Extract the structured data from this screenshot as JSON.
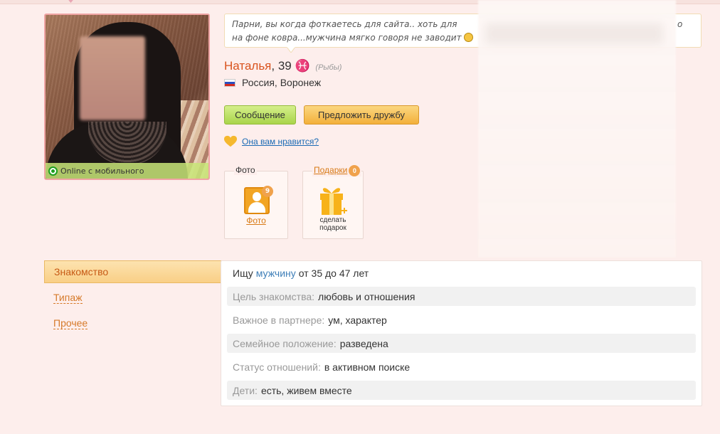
{
  "status": {
    "line1": "Парни, вы когда фоткаетесь для сайта.. хоть для",
    "line1_tail": "о",
    "line2": "на фоне ковра...мужчина мягко говоря не заводит"
  },
  "profile": {
    "name": "Наталья",
    "age": "39",
    "zodiac_symbol": "♓",
    "zodiac": "(Рыбы)",
    "location": "Россия, Воронеж",
    "online": "Online с мобильного"
  },
  "actions": {
    "message": "Сообщение",
    "friend": "Предложить дружбу",
    "like": "Она вам нравится?"
  },
  "photos": {
    "title": "Фото",
    "count": "9",
    "link": "Фото"
  },
  "gifts": {
    "title": "Подарки",
    "count": "0",
    "label_line1": "сделать",
    "label_line2": "подарок"
  },
  "nav": {
    "items": [
      {
        "label": "Знакомство",
        "active": true
      },
      {
        "label": "Типаж",
        "active": false
      },
      {
        "label": "Прочее",
        "active": false
      }
    ]
  },
  "details": {
    "seek_prefix": "Ищу",
    "seek_gender": "мужчину",
    "seek_range": "от 35 до 47 лет",
    "rows": [
      {
        "key": "Цель знакомства:",
        "value": "любовь и отношения"
      },
      {
        "key": "Важное в партнере:",
        "value": "ум, характер"
      },
      {
        "key": "Семейное положение:",
        "value": "разведена"
      },
      {
        "key": "Статус отношений:",
        "value": "в активном поиске"
      },
      {
        "key": "Дети:",
        "value": "есть, живем вместе"
      }
    ]
  },
  "colors": {
    "background": "#fdeeec",
    "name": "#d9531e",
    "link": "#1c6bb5",
    "accent_orange": "#f3b03b",
    "accent_green": "#a9d44a"
  }
}
